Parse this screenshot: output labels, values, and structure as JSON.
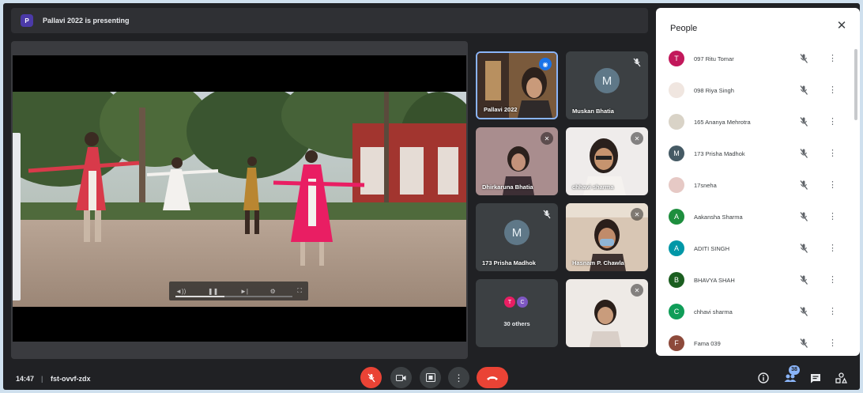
{
  "presentation": {
    "presenter_initial": "P",
    "banner_text": "Pallavi 2022 is presenting"
  },
  "tiles": [
    {
      "name": "Pallavi 2022",
      "type": "video",
      "active": true
    },
    {
      "name": "Muskan Bhatia",
      "type": "avatar",
      "initial": "M"
    },
    {
      "name": "Dhirkaruna Bhatia",
      "type": "video"
    },
    {
      "name": "chhavi sharma",
      "type": "video"
    },
    {
      "name": "173 Prisha Madhok",
      "type": "avatar",
      "initial": "M"
    },
    {
      "name": "Hasnam P. Chawla",
      "type": "video"
    },
    {
      "name": "30 others",
      "type": "others",
      "initials": [
        "T",
        "C"
      ]
    },
    {
      "name": "",
      "type": "video"
    }
  ],
  "people_panel": {
    "title": "People",
    "participants": [
      {
        "name": "097 Ritu Tomar",
        "initial": "T",
        "color": "#c2185b"
      },
      {
        "name": "098 Riya Singh",
        "initial": "",
        "color": "#f0e6e0"
      },
      {
        "name": "165 Ananya Mehrotra",
        "initial": "",
        "color": "#d9d3c7"
      },
      {
        "name": "173 Prisha Madhok",
        "initial": "M",
        "color": "#455a64"
      },
      {
        "name": "17sneha",
        "initial": "",
        "color": "#e6c9c5"
      },
      {
        "name": "Aakansha Sharma",
        "initial": "A",
        "color": "#1e8e3e"
      },
      {
        "name": "ADITI SINGH",
        "initial": "A",
        "color": "#0097a7"
      },
      {
        "name": "BHAVYA SHAH",
        "initial": "B",
        "color": "#1b5e20"
      },
      {
        "name": "chhavi sharma",
        "initial": "C",
        "color": "#0f9d58"
      },
      {
        "name": "Fama 039",
        "initial": "F",
        "color": "#8d4a3b"
      }
    ]
  },
  "bottom_bar": {
    "time": "14:47",
    "separator": "|",
    "meeting_code": "fst-ovvf-zdx",
    "people_count": "38"
  }
}
